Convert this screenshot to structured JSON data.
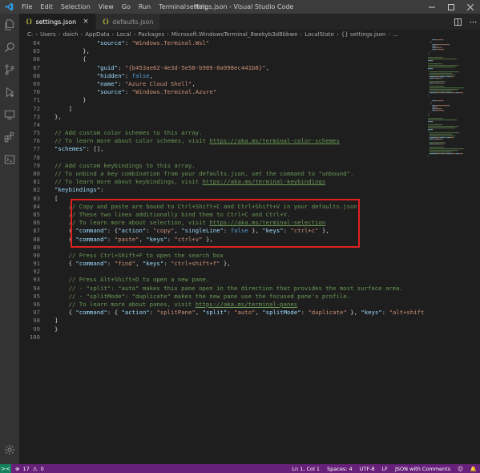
{
  "titlebar": {
    "menu": [
      "File",
      "Edit",
      "Selection",
      "View",
      "Go",
      "Run",
      "Terminal",
      "Help"
    ],
    "title": "settings.json - Visual Studio Code"
  },
  "tabs": [
    {
      "label": "settings.json",
      "icon": "{}",
      "active": true
    },
    {
      "label": "defaults.json",
      "icon": "{}",
      "active": false
    }
  ],
  "breadcrumb": [
    "C:",
    "Users",
    "daich",
    "AppData",
    "Local",
    "Packages",
    "Microsoft.WindowsTerminal_8wekyb3d8bbwe",
    "LocalState",
    "{} settings.json",
    "..."
  ],
  "editor": {
    "lines": [
      {
        "n": "64",
        "tokens": [
          [
            "pun",
            "            "
          ],
          [
            "key",
            "\"source\""
          ],
          [
            "pun",
            ": "
          ],
          [
            "str",
            "\"Windows.Terminal.Wsl\""
          ]
        ]
      },
      {
        "n": "65",
        "tokens": [
          [
            "pun",
            "        },"
          ]
        ]
      },
      {
        "n": "66",
        "tokens": [
          [
            "pun",
            "        {"
          ]
        ]
      },
      {
        "n": "67",
        "tokens": [
          [
            "pun",
            "            "
          ],
          [
            "key",
            "\"guid\""
          ],
          [
            "pun",
            ": "
          ],
          [
            "str",
            "\"{b453ae62-4e3d-5e58-b989-0a998ec441b8}\""
          ],
          [
            "pun",
            ","
          ]
        ]
      },
      {
        "n": "68",
        "tokens": [
          [
            "pun",
            "            "
          ],
          [
            "key",
            "\"hidden\""
          ],
          [
            "pun",
            ": "
          ],
          [
            "kw",
            "false"
          ],
          [
            "pun",
            ","
          ]
        ]
      },
      {
        "n": "69",
        "tokens": [
          [
            "pun",
            "            "
          ],
          [
            "key",
            "\"name\""
          ],
          [
            "pun",
            ": "
          ],
          [
            "str",
            "\"Azure Cloud Shell\""
          ],
          [
            "pun",
            ","
          ]
        ]
      },
      {
        "n": "70",
        "tokens": [
          [
            "pun",
            "            "
          ],
          [
            "key",
            "\"source\""
          ],
          [
            "pun",
            ": "
          ],
          [
            "str",
            "\"Windows.Terminal.Azure\""
          ]
        ]
      },
      {
        "n": "71",
        "tokens": [
          [
            "pun",
            "        }"
          ]
        ]
      },
      {
        "n": "72",
        "tokens": [
          [
            "pun",
            "    ]"
          ]
        ]
      },
      {
        "n": "73",
        "tokens": [
          [
            "pun",
            "},"
          ]
        ]
      },
      {
        "n": "74",
        "tokens": []
      },
      {
        "n": "75",
        "tokens": [
          [
            "com",
            "// Add custom color schemes to this array."
          ]
        ]
      },
      {
        "n": "76",
        "tokens": [
          [
            "com",
            "// To learn more about color schemes, visit "
          ],
          [
            "url",
            "https://aka.ms/terminal-color-schemes"
          ]
        ]
      },
      {
        "n": "77",
        "tokens": [
          [
            "key",
            "\"schemes\""
          ],
          [
            "pun",
            ": [],"
          ]
        ]
      },
      {
        "n": "78",
        "tokens": []
      },
      {
        "n": "79",
        "tokens": [
          [
            "com",
            "// Add custom keybindings to this array."
          ]
        ]
      },
      {
        "n": "80",
        "tokens": [
          [
            "com",
            "// To unbind a key combination from your defaults.json, set the command to \"unbound\"."
          ]
        ]
      },
      {
        "n": "81",
        "tokens": [
          [
            "com",
            "// To learn more about keybindings, visit "
          ],
          [
            "url",
            "https://aka.ms/terminal-keybindings"
          ]
        ]
      },
      {
        "n": "82",
        "tokens": [
          [
            "key",
            "\"keybindings\""
          ],
          [
            "pun",
            ":"
          ]
        ]
      },
      {
        "n": "83",
        "tokens": [
          [
            "pun",
            "["
          ]
        ]
      },
      {
        "n": "84",
        "tokens": [
          [
            "pun",
            "    "
          ],
          [
            "com",
            "// Copy and paste are bound to Ctrl+Shift+C and Ctrl+Shift+V in your defaults.json."
          ]
        ]
      },
      {
        "n": "85",
        "tokens": [
          [
            "pun",
            "    "
          ],
          [
            "com",
            "// These two lines additionally bind them to Ctrl+C and Ctrl+V."
          ]
        ]
      },
      {
        "n": "86",
        "tokens": [
          [
            "pun",
            "    "
          ],
          [
            "com",
            "// To learn more about selection, visit "
          ],
          [
            "url",
            "https://aka.ms/terminal-selection"
          ]
        ]
      },
      {
        "n": "87",
        "tokens": [
          [
            "pun",
            "    { "
          ],
          [
            "key",
            "\"command\""
          ],
          [
            "pun",
            ": {"
          ],
          [
            "key",
            "\"action\""
          ],
          [
            "pun",
            ": "
          ],
          [
            "str",
            "\"copy\""
          ],
          [
            "pun",
            ", "
          ],
          [
            "key",
            "\"singleLine\""
          ],
          [
            "pun",
            ": "
          ],
          [
            "kw",
            "false"
          ],
          [
            "pun",
            " }, "
          ],
          [
            "key",
            "\"keys\""
          ],
          [
            "pun",
            ": "
          ],
          [
            "str",
            "\"ctrl+c\""
          ],
          [
            "pun",
            " },"
          ]
        ]
      },
      {
        "n": "88",
        "tokens": [
          [
            "pun",
            "    { "
          ],
          [
            "key",
            "\"command\""
          ],
          [
            "pun",
            ": "
          ],
          [
            "str",
            "\"paste\""
          ],
          [
            "pun",
            ", "
          ],
          [
            "key",
            "\"keys\""
          ],
          [
            "pun",
            ": "
          ],
          [
            "str",
            "\"ctrl+v\""
          ],
          [
            "pun",
            " },"
          ]
        ]
      },
      {
        "n": "89",
        "tokens": []
      },
      {
        "n": "90",
        "tokens": [
          [
            "pun",
            "    "
          ],
          [
            "com",
            "// Press Ctrl+Shift+F to open the search box"
          ]
        ]
      },
      {
        "n": "91",
        "tokens": [
          [
            "pun",
            "    { "
          ],
          [
            "key",
            "\"command\""
          ],
          [
            "pun",
            ": "
          ],
          [
            "str",
            "\"find\""
          ],
          [
            "pun",
            ", "
          ],
          [
            "key",
            "\"keys\""
          ],
          [
            "pun",
            ": "
          ],
          [
            "str",
            "\"ctrl+shift+f\""
          ],
          [
            "pun",
            " },"
          ]
        ]
      },
      {
        "n": "92",
        "tokens": []
      },
      {
        "n": "93",
        "tokens": [
          [
            "pun",
            "    "
          ],
          [
            "com",
            "// Press Alt+Shift+D to open a new pane."
          ]
        ]
      },
      {
        "n": "94",
        "tokens": [
          [
            "pun",
            "    "
          ],
          [
            "com",
            "// - \"split\": \"auto\" makes this pane open in the direction that provides the most surface area."
          ]
        ]
      },
      {
        "n": "95",
        "tokens": [
          [
            "pun",
            "    "
          ],
          [
            "com",
            "// - \"splitMode\": \"duplicate\" makes the new pane use the focused pane's profile."
          ]
        ]
      },
      {
        "n": "96",
        "tokens": [
          [
            "pun",
            "    "
          ],
          [
            "com",
            "// To learn more about panes, visit "
          ],
          [
            "url",
            "https://aka.ms/terminal-panes"
          ]
        ]
      },
      {
        "n": "97",
        "tokens": [
          [
            "pun",
            "    { "
          ],
          [
            "key",
            "\"command\""
          ],
          [
            "pun",
            ": { "
          ],
          [
            "key",
            "\"action\""
          ],
          [
            "pun",
            ": "
          ],
          [
            "str",
            "\"splitPane\""
          ],
          [
            "pun",
            ", "
          ],
          [
            "key",
            "\"split\""
          ],
          [
            "pun",
            ": "
          ],
          [
            "str",
            "\"auto\""
          ],
          [
            "pun",
            ", "
          ],
          [
            "key",
            "\"splitMode\""
          ],
          [
            "pun",
            ": "
          ],
          [
            "str",
            "\"duplicate\""
          ],
          [
            "pun",
            " }, "
          ],
          [
            "key",
            "\"keys\""
          ],
          [
            "pun",
            ": "
          ],
          [
            "str",
            "\"alt+shift+d"
          ]
        ]
      },
      {
        "n": "98",
        "tokens": [
          [
            "pun",
            "]"
          ]
        ]
      },
      {
        "n": "99",
        "tokens": [
          [
            "pun",
            "}"
          ]
        ]
      },
      {
        "n": "100",
        "tokens": []
      }
    ]
  },
  "statusbar": {
    "remote_icon": "><",
    "problems": "17",
    "warnings": "0",
    "position": "Ln 1, Col 1",
    "spaces": "Spaces: 4",
    "encoding": "UTF-8",
    "eol": "LF",
    "language": "JSON with Comments"
  },
  "colors": {
    "accent_status": "#68217a",
    "highlight_box": "#e02020"
  }
}
